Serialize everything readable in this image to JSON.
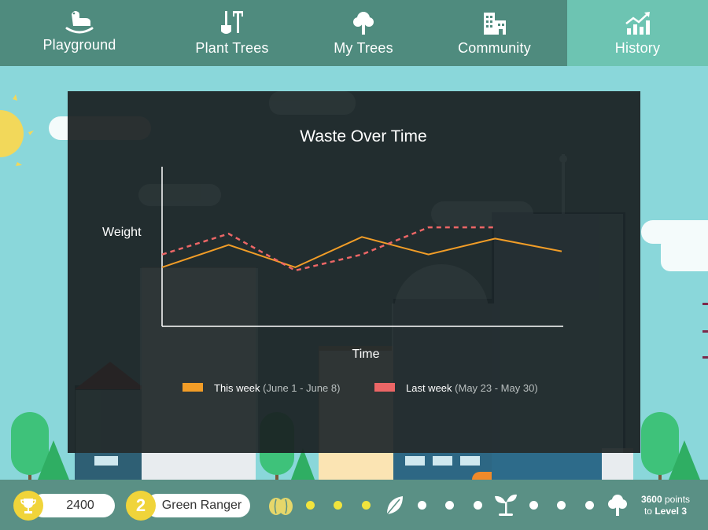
{
  "nav": {
    "items": [
      {
        "label": "Playground",
        "icon": "rocking-horse-icon"
      },
      {
        "label": "Plant Trees",
        "icon": "shovel-rake-icon"
      },
      {
        "label": "My Trees",
        "icon": "tree-icon"
      },
      {
        "label": "Community",
        "icon": "buildings-icon"
      },
      {
        "label": "History",
        "icon": "trend-chart-icon"
      }
    ],
    "active": "History"
  },
  "chart_data": {
    "type": "line",
    "title": "Waste Over Time",
    "xlabel": "Time",
    "ylabel": "Weight",
    "series": [
      {
        "name": "This week (June 1 - June 8)",
        "color": "#f29d27",
        "style": "solid",
        "values": [
          0.37,
          0.51,
          0.37,
          0.56,
          0.45,
          0.55,
          0.47
        ]
      },
      {
        "name": "Last week (May 23 - May 30)",
        "color": "#ec6666",
        "style": "dashed",
        "values": [
          0.45,
          0.58,
          0.35,
          0.45,
          0.62,
          0.62
        ]
      }
    ],
    "x": [
      0,
      1,
      2,
      3,
      4,
      5,
      6
    ],
    "legend": [
      {
        "label": "This week",
        "range": "(June 1 - June 8)",
        "color": "#f29d27"
      },
      {
        "label": "Last week",
        "range": "(May 23 - May 30)",
        "color": "#ec6666"
      }
    ],
    "grid": false
  },
  "status": {
    "score": "2400",
    "level_number": "2",
    "level_name": "Green Ranger",
    "points_needed": "3600",
    "points_word": "points",
    "to_word": "to",
    "next_level": "Level 3"
  },
  "colors": {
    "nav_bg": "#4f8b7e",
    "nav_active": "#6dc4b2",
    "sky": "#8ad7da",
    "bottom_bar": "#5a9085",
    "badge_yellow": "#f0d43a"
  },
  "progress": {
    "yellow_dots": 3,
    "white_dots": 6,
    "icons": [
      "seeds-icon",
      "leaf-icon",
      "sprout-icon",
      "tree-icon"
    ]
  }
}
